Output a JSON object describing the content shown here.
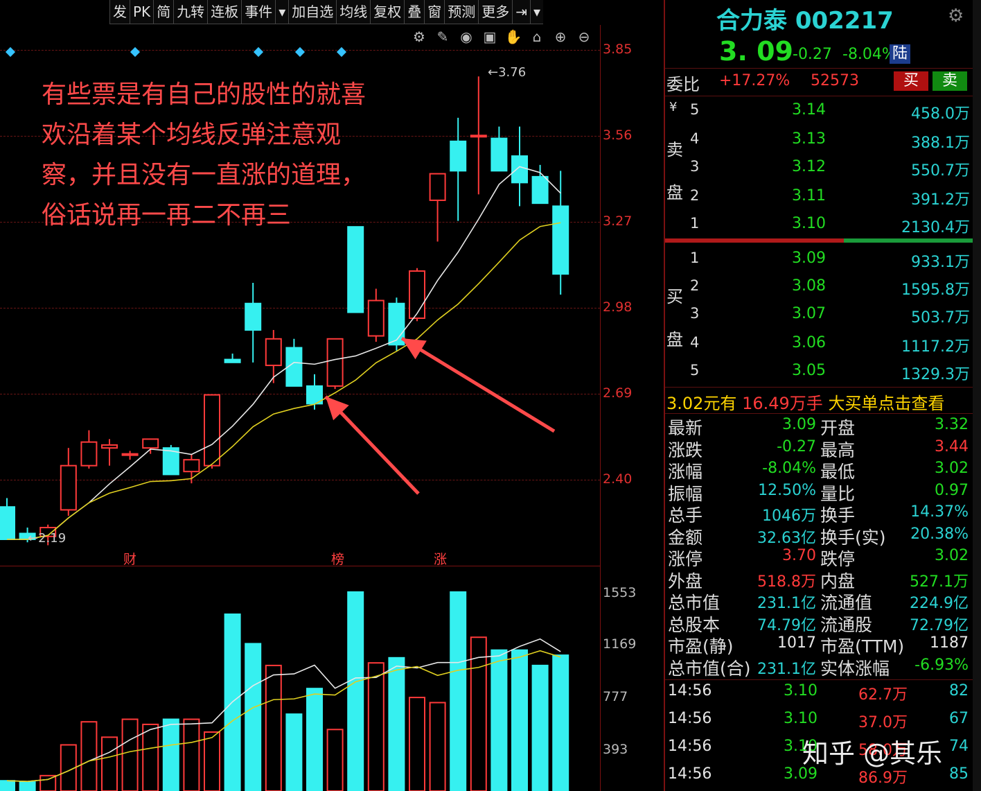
{
  "toolbar": [
    "发",
    "PK",
    "简",
    "九转",
    "连板",
    "事件",
    "▾",
    "加自选",
    "均线",
    "复权",
    "叠",
    "窗",
    "预测",
    "更多",
    "⇥",
    "▾"
  ],
  "price_axis": [
    "3.85",
    "3.56",
    "3.27",
    "2.98",
    "2.69",
    "2.40"
  ],
  "volume_axis": [
    "1553",
    "1169",
    "777",
    "393"
  ],
  "annotation": "有些票是有自己的股性的就喜欢沿着某个均线反弹注意观察，并且没有一直涨的道理，俗话说再一再二不再三",
  "high_mark": "3.76",
  "low_mark": "2.19",
  "events": [
    "财",
    "榜",
    "涨"
  ],
  "chart_data": {
    "type": "candlestick",
    "ohlc": [
      [
        2.3,
        2.33,
        2.19,
        2.19
      ],
      [
        2.21,
        2.23,
        2.18,
        2.19
      ],
      [
        2.2,
        2.24,
        2.17,
        2.23
      ],
      [
        2.29,
        2.5,
        2.27,
        2.44
      ],
      [
        2.44,
        2.56,
        2.43,
        2.52
      ],
      [
        2.5,
        2.53,
        2.44,
        2.51
      ],
      [
        2.48,
        2.49,
        2.46,
        2.48
      ],
      [
        2.5,
        2.53,
        2.48,
        2.53
      ],
      [
        2.5,
        2.51,
        2.41,
        2.41
      ],
      [
        2.42,
        2.48,
        2.38,
        2.46
      ],
      [
        2.44,
        2.68,
        2.43,
        2.68
      ],
      [
        2.8,
        2.82,
        2.79,
        2.79
      ],
      [
        2.99,
        3.06,
        2.79,
        2.9
      ],
      [
        2.78,
        2.9,
        2.72,
        2.87
      ],
      [
        2.84,
        2.87,
        2.71,
        2.71
      ],
      [
        2.71,
        2.75,
        2.63,
        2.65
      ],
      [
        2.71,
        2.87,
        2.7,
        2.87
      ],
      [
        3.25,
        3.25,
        2.96,
        2.96
      ],
      [
        2.88,
        3.04,
        2.86,
        3.0
      ],
      [
        2.99,
        3.01,
        2.83,
        2.85
      ],
      [
        2.94,
        3.11,
        2.93,
        3.1
      ],
      [
        3.34,
        3.34,
        3.2,
        3.43
      ],
      [
        3.54,
        3.62,
        3.27,
        3.44
      ],
      [
        3.56,
        3.76,
        3.36,
        3.56
      ],
      [
        3.55,
        3.59,
        3.44,
        3.44
      ],
      [
        3.49,
        3.59,
        3.32,
        3.4
      ],
      [
        3.42,
        3.46,
        3.33,
        3.33
      ],
      [
        3.32,
        3.44,
        3.02,
        3.09
      ]
    ],
    "colors_up_down": [
      "#ff3a3a",
      "#36f0f0"
    ],
    "volume": [
      80,
      70,
      120,
      360,
      540,
      420,
      560,
      520,
      560,
      560,
      460,
      1380,
      1150,
      980,
      600,
      800,
      480,
      1553,
      1000,
      1040,
      730,
      690,
      1553,
      1200,
      1100,
      1100,
      980,
      1060
    ],
    "ylim": [
      2.19,
      3.85
    ],
    "vol_ylim": [
      0,
      1553
    ]
  },
  "quote": {
    "name": "合力泰 002217",
    "price": "3. 09",
    "change": "-0.27",
    "pct": "-8.04%",
    "market": "陆",
    "wb_label": "委比",
    "wb_pct": "+17.27%",
    "wb_vol": "52573",
    "buy": "买",
    "sell": "卖",
    "yen": "¥",
    "sell_label": [
      "卖",
      "盘"
    ],
    "buy_label": [
      "买",
      "盘"
    ],
    "asks": [
      {
        "lvl": "5",
        "p": "3.14",
        "v": "458.0万"
      },
      {
        "lvl": "4",
        "p": "3.13",
        "v": "388.1万"
      },
      {
        "lvl": "3",
        "p": "3.12",
        "v": "550.7万"
      },
      {
        "lvl": "2",
        "p": "3.11",
        "v": "391.2万"
      },
      {
        "lvl": "1",
        "p": "3.10",
        "v": "2130.4万"
      }
    ],
    "bids": [
      {
        "lvl": "1",
        "p": "3.09",
        "v": "933.1万"
      },
      {
        "lvl": "2",
        "p": "3.08",
        "v": "1595.8万"
      },
      {
        "lvl": "3",
        "p": "3.07",
        "v": "503.7万"
      },
      {
        "lvl": "4",
        "p": "3.06",
        "v": "1117.2万"
      },
      {
        "lvl": "5",
        "p": "3.05",
        "v": "1329.3万"
      }
    ],
    "big_a": "3.02元有",
    "big_b": "16.49万手",
    "big_c": "大买单点击查看"
  },
  "info": [
    {
      "l": "最新",
      "v": "3.09",
      "vc": "g",
      "l2": "开盘",
      "v2": "3.32",
      "v2c": "g"
    },
    {
      "l": "涨跌",
      "v": "-0.27",
      "vc": "g",
      "l2": "最高",
      "v2": "3.44",
      "v2c": "r"
    },
    {
      "l": "涨幅",
      "v": "-8.04%",
      "vc": "g",
      "l2": "最低",
      "v2": "3.02",
      "v2c": "g"
    },
    {
      "l": "振幅",
      "v": "12.50%",
      "vc": "c",
      "l2": "量比",
      "v2": "0.97",
      "v2c": "g"
    },
    {
      "l": "总手",
      "v": "1046万",
      "vc": "c",
      "l2": "换手",
      "v2": "14.37%",
      "v2c": "c"
    },
    {
      "l": "金额",
      "v": "32.63亿",
      "vc": "c",
      "l2": "换手(实)",
      "v2": "20.38%",
      "v2c": "c"
    },
    {
      "l": "涨停",
      "v": "3.70",
      "vc": "r",
      "l2": "跌停",
      "v2": "3.02",
      "v2c": "g"
    },
    {
      "l": "外盘",
      "v": "518.8万",
      "vc": "r",
      "l2": "内盘",
      "v2": "527.1万",
      "v2c": "g"
    },
    {
      "l": "总市值",
      "v": "231.1亿",
      "vc": "c",
      "l2": "流通值",
      "v2": "224.9亿",
      "v2c": "c"
    },
    {
      "l": "总股本",
      "v": "74.79亿",
      "vc": "c",
      "l2": "流通股",
      "v2": "72.79亿",
      "v2c": "c"
    },
    {
      "l": "市盈(静)",
      "v": "1017",
      "vc": "w",
      "l2": "市盈(TTM)",
      "v2": "1187",
      "v2c": "w"
    },
    {
      "l": "总市值(合)",
      "v": "231.1亿",
      "vc": "c",
      "l2": "实体涨幅",
      "v2": "-6.93%",
      "v2c": "g"
    }
  ],
  "ticks": [
    {
      "t": "14:56",
      "p": "3.10",
      "pc": "g",
      "v": "62.7万",
      "n": "82"
    },
    {
      "t": "14:56",
      "p": "3.10",
      "pc": "g",
      "v": "37.0万",
      "n": "67"
    },
    {
      "t": "14:56",
      "p": "3.10",
      "pc": "g",
      "v": "58.0万",
      "n": "74"
    },
    {
      "t": "14:56",
      "p": "3.09",
      "pc": "g",
      "v": "86.9万",
      "n": "85"
    }
  ],
  "watermark": "知乎 @其乐"
}
